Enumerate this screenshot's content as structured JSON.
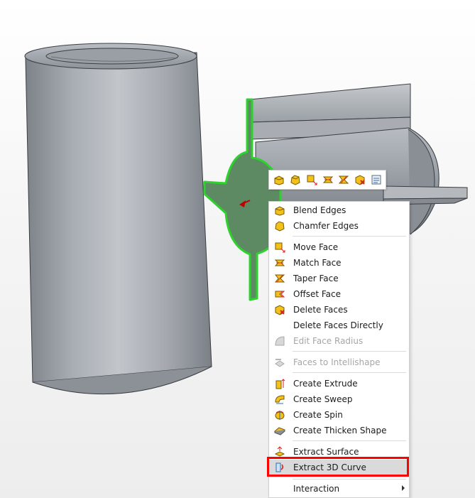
{
  "viewport": {
    "name": "3d-viewport"
  },
  "mini_toolbar": {
    "icons": [
      "blend-edges-icon",
      "chamfer-edges-icon",
      "move-face-icon",
      "match-face-icon",
      "taper-face-icon",
      "delete-faces-icon",
      "properties-icon"
    ]
  },
  "menu": {
    "items": [
      {
        "label": "Blend Edges",
        "icon": "blend-edges-icon",
        "enabled": true
      },
      {
        "label": "Chamfer Edges",
        "icon": "chamfer-edges-icon",
        "enabled": true
      },
      {
        "label": "Move Face",
        "icon": "move-face-icon",
        "enabled": true
      },
      {
        "label": "Match Face",
        "icon": "match-face-icon",
        "enabled": true
      },
      {
        "label": "Taper Face",
        "icon": "taper-face-icon",
        "enabled": true
      },
      {
        "label": "Offset Face",
        "icon": "offset-face-icon",
        "enabled": true
      },
      {
        "label": "Delete Faces",
        "icon": "delete-faces-icon",
        "enabled": true
      },
      {
        "label": "Delete Faces Directly",
        "icon": "",
        "enabled": true
      },
      {
        "label": "Edit Face Radius",
        "icon": "edit-face-radius-icon",
        "enabled": false
      },
      {
        "label": "Faces to Intellishape",
        "icon": "faces-to-intellishape-icon",
        "enabled": false
      },
      {
        "label": "Create Extrude",
        "icon": "create-extrude-icon",
        "enabled": true
      },
      {
        "label": "Create Sweep",
        "icon": "create-sweep-icon",
        "enabled": true
      },
      {
        "label": "Create Spin",
        "icon": "create-spin-icon",
        "enabled": true
      },
      {
        "label": "Create Thicken Shape",
        "icon": "create-thicken-shape-icon",
        "enabled": true
      },
      {
        "label": "Extract Surface",
        "icon": "extract-surface-icon",
        "enabled": true
      },
      {
        "label": "Extract 3D Curve",
        "icon": "extract-3d-curve-icon",
        "enabled": true,
        "highlighted": true
      },
      {
        "label": "Interaction",
        "icon": "",
        "enabled": true,
        "submenu": true
      }
    ]
  },
  "colors": {
    "selection_green": "#2fd12f",
    "selected_face": "#5d8a62",
    "highlight_border": "#ff0000",
    "icon_yellow": "#f2c21b"
  }
}
